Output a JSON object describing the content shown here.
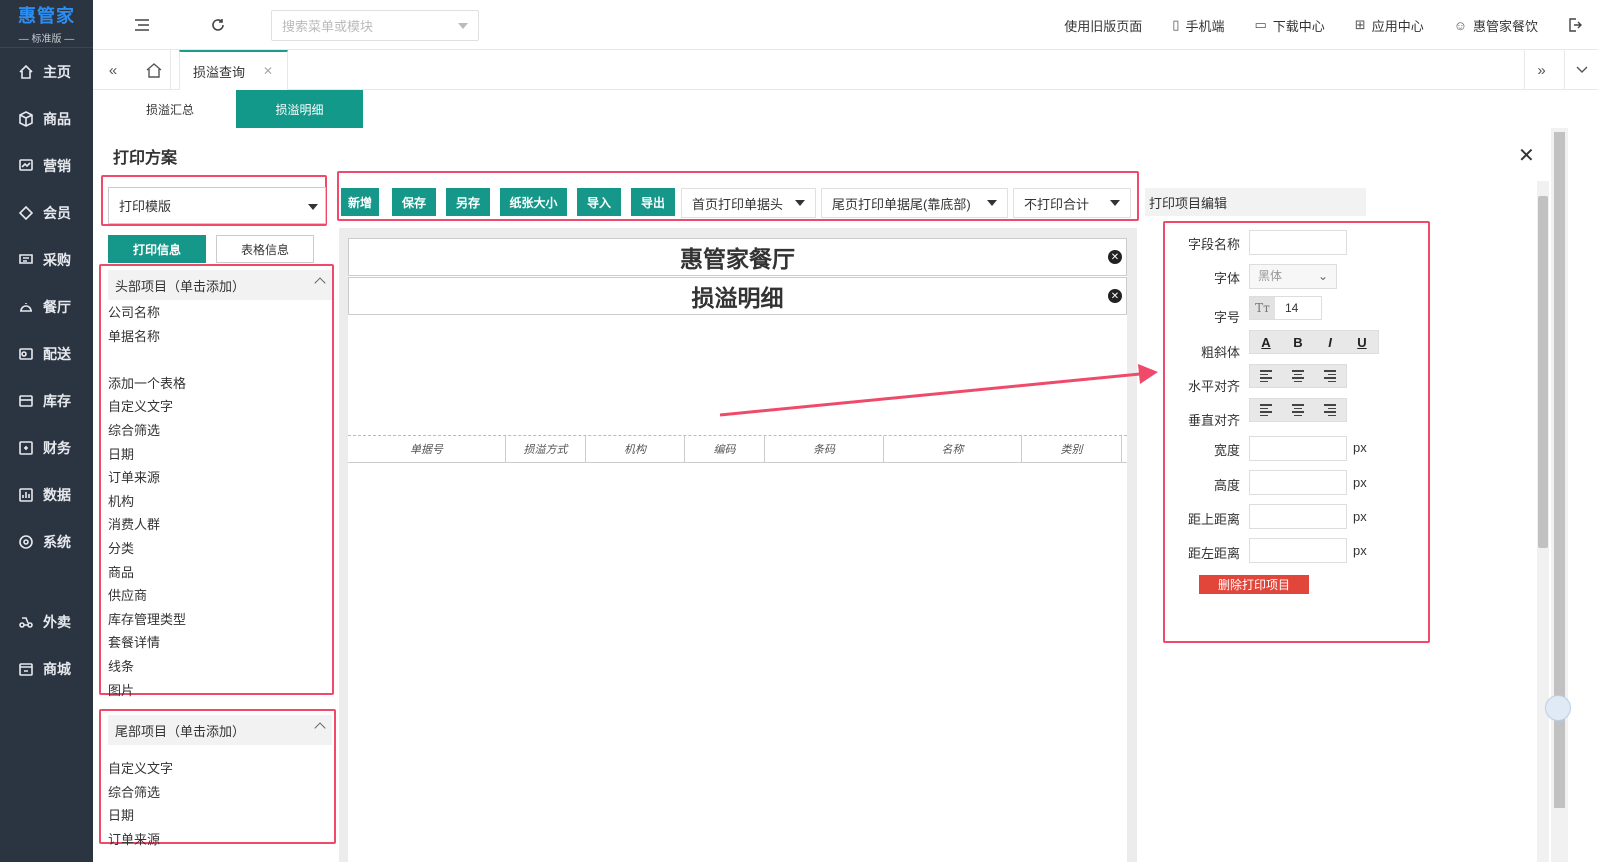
{
  "brand": {
    "name": "惠管家",
    "edition": "标准版"
  },
  "sidebar": {
    "items": [
      {
        "label": "主页",
        "icon": "home-icon"
      },
      {
        "label": "商品",
        "icon": "box-icon"
      },
      {
        "label": "营销",
        "icon": "chart-icon"
      },
      {
        "label": "会员",
        "icon": "diamond-icon"
      },
      {
        "label": "采购",
        "icon": "cart-icon"
      },
      {
        "label": "餐厅",
        "icon": "dish-icon"
      },
      {
        "label": "配送",
        "icon": "delivery-icon"
      },
      {
        "label": "库存",
        "icon": "warehouse-icon"
      },
      {
        "label": "财务",
        "icon": "finance-icon"
      },
      {
        "label": "数据",
        "icon": "data-icon"
      },
      {
        "label": "系统",
        "icon": "settings-icon"
      },
      {
        "label": "外卖",
        "icon": "takeout-icon"
      },
      {
        "label": "商城",
        "icon": "shop-icon"
      }
    ]
  },
  "topbar": {
    "search_placeholder": "搜索菜单或模块",
    "links": [
      {
        "label": "使用旧版页面",
        "icon": ""
      },
      {
        "label": "手机端",
        "icon": "phone-icon"
      },
      {
        "label": "下载中心",
        "icon": "download-icon"
      },
      {
        "label": "应用中心",
        "icon": "apps-icon"
      },
      {
        "label": "惠管家餐饮",
        "icon": "user-icon"
      }
    ]
  },
  "tabs": {
    "active": "损溢查询"
  },
  "subtabs": [
    "损溢汇总",
    "损溢明细"
  ],
  "panel": {
    "title": "打印方案"
  },
  "template_select": "打印模版",
  "left_buttons": {
    "print_info": "打印信息",
    "table_info": "表格信息"
  },
  "header_section": {
    "title": "头部项目（单击添加）",
    "items": [
      "公司名称",
      "单据名称",
      "",
      "添加一个表格",
      "自定义文字",
      "综合筛选",
      "日期",
      "订单来源",
      "机构",
      "消费人群",
      "分类",
      "商品",
      "供应商",
      "库存管理类型",
      "套餐详情",
      "线条",
      "图片"
    ]
  },
  "footer_section": {
    "title": "尾部项目（单击添加）",
    "items": [
      "自定义文字",
      "综合筛选",
      "日期",
      "订单来源"
    ]
  },
  "toolbar": {
    "buttons": [
      "新增",
      "保存",
      "另存",
      "纸张大小",
      "导入",
      "导出"
    ],
    "dropdowns": [
      "首页打印单据头",
      "尾页打印单据尾(靠底部)",
      "不打印合计"
    ]
  },
  "preview": {
    "company": "惠管家餐厅",
    "doc_title": "损溢明细",
    "columns": [
      "单据号",
      "损溢方式",
      "机构",
      "编码",
      "条码",
      "名称",
      "类别"
    ]
  },
  "editor": {
    "title": "打印项目编辑",
    "field_name_label": "字段名称",
    "font_label": "字体",
    "font_value": "黑体",
    "size_label": "字号",
    "size_value": "14",
    "style_label": "粗斜体",
    "style_buttons": [
      "A",
      "B",
      "I",
      "U"
    ],
    "halign_label": "水平对齐",
    "valign_label": "垂直对齐",
    "width_label": "宽度",
    "height_label": "高度",
    "top_label": "距上距离",
    "left_label": "距左距离",
    "unit": "px",
    "delete_button": "删除打印项目"
  },
  "colors": {
    "accent": "#15978a",
    "highlight": "#f04a6a",
    "danger": "#e2463b",
    "sidebar": "#2b3441"
  }
}
